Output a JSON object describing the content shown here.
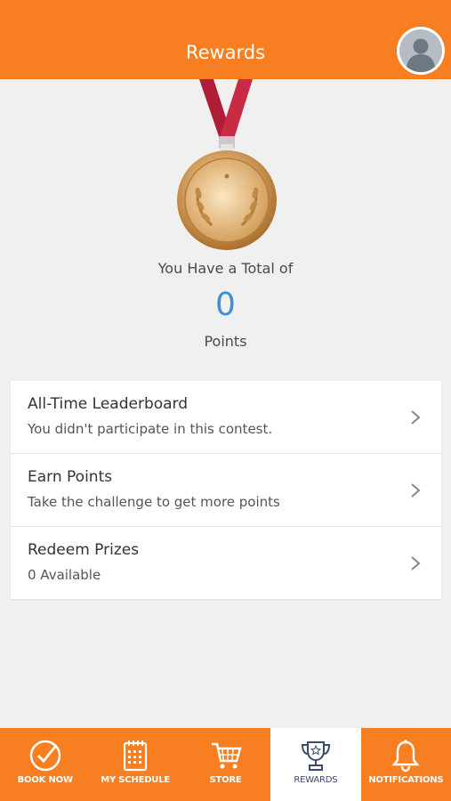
{
  "header": {
    "title": "Rewards",
    "avatar_icon": "user-avatar-icon"
  },
  "summary": {
    "total_label": "You Have a Total of",
    "points_value": "0",
    "points_label": "Points"
  },
  "menu": [
    {
      "title": "All-Time Leaderboard",
      "subtitle": "You didn't participate in this contest."
    },
    {
      "title": "Earn Points",
      "subtitle": "Take the challenge to get more points"
    },
    {
      "title": "Redeem Prizes",
      "subtitle": "0 Available"
    }
  ],
  "tabs": [
    {
      "label": "BOOK NOW",
      "icon": "check-circle-icon"
    },
    {
      "label": "MY SCHEDULE",
      "icon": "calendar-icon"
    },
    {
      "label": "STORE",
      "icon": "cart-icon"
    },
    {
      "label": "REWARDS",
      "icon": "trophy-icon",
      "active": true
    },
    {
      "label": "NOTIFICATIONS",
      "icon": "bell-icon"
    }
  ],
  "colors": {
    "brand_orange": "#f77f22",
    "points_blue": "#3d8fd6"
  }
}
